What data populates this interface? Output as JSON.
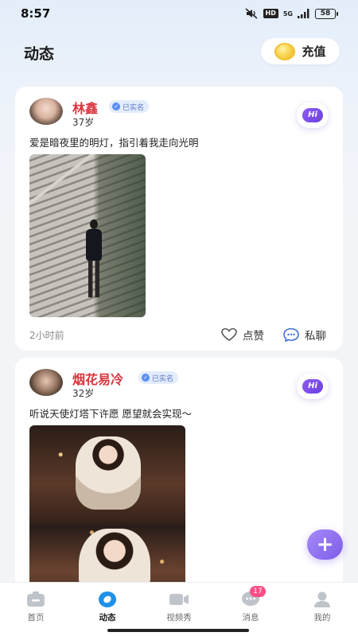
{
  "status_bar": {
    "time": "8:57",
    "hd": "HD",
    "network": "5G",
    "battery": "58"
  },
  "header": {
    "title": "动态",
    "recharge_label": "充值"
  },
  "posts": [
    {
      "name": "林鑫",
      "verified": "已实名",
      "age": "37岁",
      "text": "爱是暗夜里的明灯，指引着我走向光明",
      "time": "2小时前",
      "hi": "Hi",
      "like_label": "点赞",
      "chat_label": "私聊"
    },
    {
      "name": "烟花易冷",
      "verified": "已实名",
      "age": "32岁",
      "text": "听说天使灯塔下许愿 愿望就会实现～",
      "hi": "Hi"
    }
  ],
  "fab": {
    "symbol": "+"
  },
  "nav": {
    "items": [
      {
        "label": "首页",
        "icon": "home-icon"
      },
      {
        "label": "动态",
        "icon": "dynamic-icon",
        "active": true
      },
      {
        "label": "视频秀",
        "icon": "video-icon"
      },
      {
        "label": "消息",
        "icon": "message-icon",
        "badge": "17"
      },
      {
        "label": "我的",
        "icon": "profile-icon"
      }
    ]
  },
  "colors": {
    "name_red": "#d9363e",
    "accent_purple": "#7c5ce6",
    "badge_pink": "#ff4d86"
  }
}
